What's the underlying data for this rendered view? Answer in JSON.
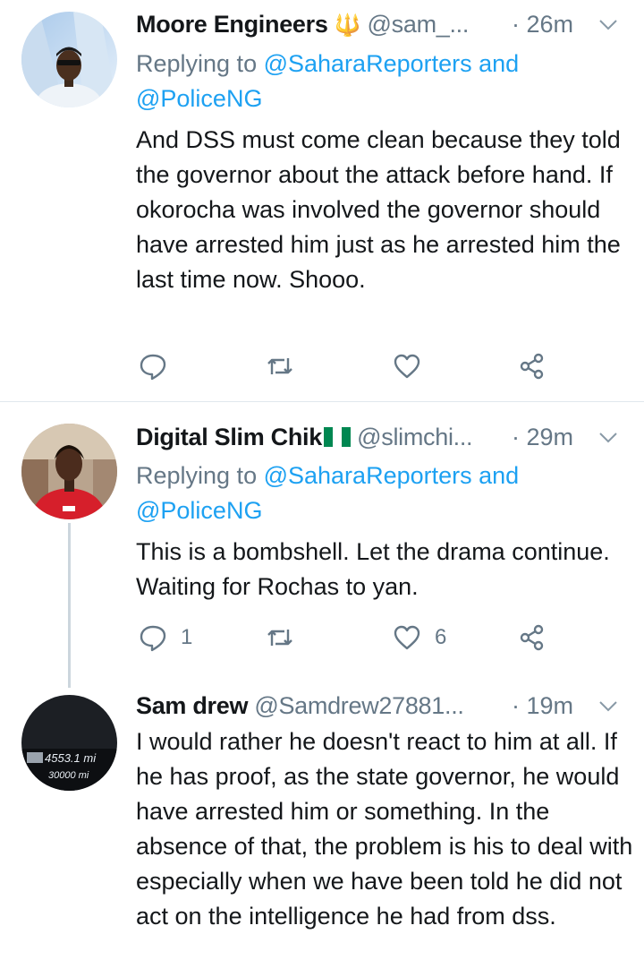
{
  "tweets": [
    {
      "name": "Moore Engineers",
      "name_emoji": "🔱",
      "handle": "@sam_...",
      "time": "· 26m",
      "replying_prefix": "Replying to ",
      "replying_to": "@SaharaReporters and @PoliceNG",
      "text": "And DSS must come clean because they told the governor about the attack before hand. If okorocha was involved the governor should have arrested him just as he arrested him the last time now. Shooo.",
      "reply_count": "",
      "retweet_count": "",
      "like_count": ""
    },
    {
      "name": "Digital Slim Chik",
      "name_emoji": "",
      "handle": "@slimchi...",
      "time": "· 29m",
      "replying_prefix": "Replying to ",
      "replying_to": "@SaharaReporters and @PoliceNG",
      "text": "This is a bombshell. Let the drama continue. Waiting for Rochas to yan.",
      "reply_count": "1",
      "retweet_count": "",
      "like_count": "6"
    },
    {
      "name": "Sam drew",
      "handle": "@Samdrew27881...",
      "time": "· 19m",
      "text": "I would rather he doesn't react to him at all. If he has proof, as the state governor, he would have arrested him or something. In the absence of that, the problem is his to deal with especially when we have been told he did not act on the intelligence he had from dss.",
      "avatar_odometer": [
        "4553.1 mi",
        "30000 mi"
      ]
    }
  ],
  "colors": {
    "link": "#1da1f2",
    "muted": "#657786",
    "text": "#14171a",
    "divider": "#e1e8ed"
  }
}
